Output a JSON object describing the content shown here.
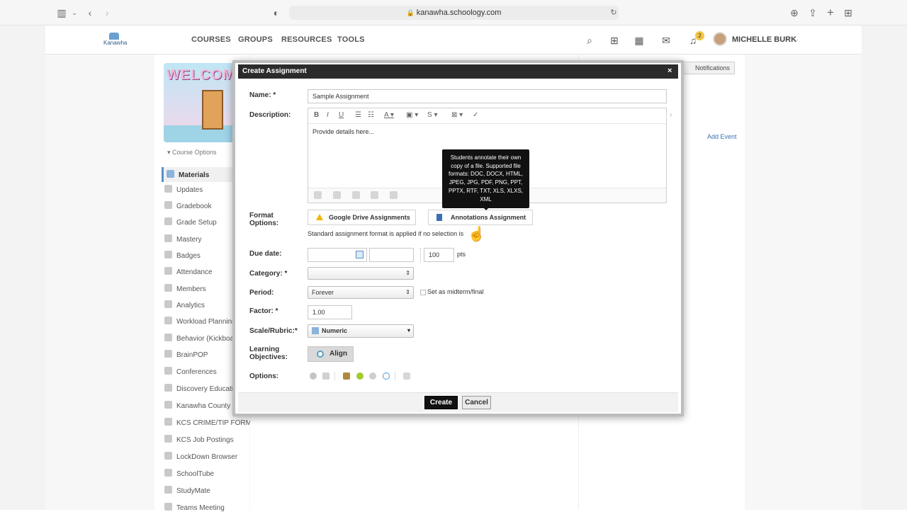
{
  "browser": {
    "url": "kanawha.schoology.com",
    "icons": [
      "sidebar-icon",
      "chevron-down-icon",
      "back-icon",
      "forward-icon",
      "shield-icon",
      "lock-icon",
      "reload-icon",
      "download-icon",
      "share-icon",
      "new-tab-icon",
      "tab-overview-icon"
    ]
  },
  "header": {
    "logo_text": "Kanawha",
    "nav": [
      "COURSES",
      "GROUPS",
      "RESOURCES",
      "TOOLS"
    ],
    "notification_count": "2",
    "user_name": "MICHELLE BURK"
  },
  "course": {
    "banner_text": "WELCOME",
    "options_label": "Course Options",
    "sidebar": [
      "Materials",
      "Updates",
      "Gradebook",
      "Grade Setup",
      "Mastery",
      "Badges",
      "Attendance",
      "Members",
      "Analytics",
      "Workload Planning",
      "Behavior (Kickboard",
      "BrainPOP",
      "Conferences",
      "Discovery Educatio",
      "Kanawha County Sc",
      "KCS CRIME/TIP FORM",
      "KCS Job Postings",
      "LockDown Browser",
      "SchoolTube",
      "StudyMate",
      "Teams Meeting"
    ]
  },
  "right_panel": {
    "notifications_label": "Notifications",
    "add_event_label": "Add Event"
  },
  "modal": {
    "title": "Create Assignment",
    "close": "×",
    "name_label": "Name: *",
    "name_value": "Sample Assignment",
    "description_label": "Description:",
    "description_placeholder": "Provide details here...",
    "format_label": "Format Options:",
    "google_drive_label": "Google Drive Assignments",
    "annotations_label": "Annotations Assignment",
    "tooltip": "Students annotate their own copy of a file. Supported file formats: DOC, DOCX, HTML, JPEG, JPG, PDF, PNG, PPT, PPTX, RTF, TXT, XLS, XLXS, XML",
    "standard_note": "Standard assignment format is applied if no selection is",
    "due_date_label": "Due date:",
    "points_value": "100",
    "points_unit": "pts",
    "category_label": "Category: *",
    "category_value": "",
    "period_label": "Period:",
    "period_value": "Forever",
    "midterm_label": "Set as midterm/final",
    "factor_label": "Factor: *",
    "factor_value": "1.00",
    "scale_label": "Scale/Rubric:*",
    "scale_value": "Numeric",
    "objectives_label": "Learning Objectives:",
    "align_label": "Align",
    "options_label": "Options:",
    "create_label": "Create",
    "cancel_label": "Cancel"
  }
}
